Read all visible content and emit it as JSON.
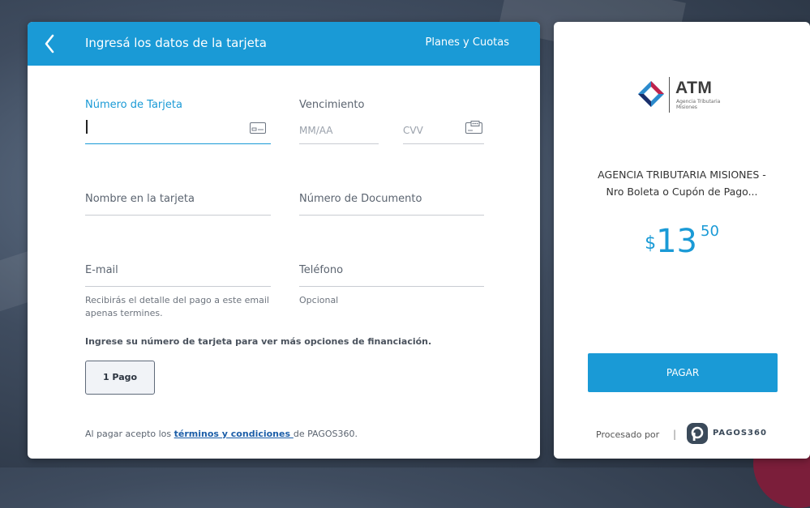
{
  "header": {
    "title": "Ingresá los datos de la tarjeta",
    "plans_link": "Planes y Cuotas"
  },
  "form": {
    "card_number": {
      "label": "Número de Tarjeta",
      "value": ""
    },
    "expiry": {
      "label": "Vencimiento",
      "placeholder": "MM/AA"
    },
    "cvv": {
      "placeholder": "CVV"
    },
    "cardholder_name": {
      "label": "Nombre en la tarjeta"
    },
    "document_number": {
      "label": "Número de Documento"
    },
    "email": {
      "label": "E-mail",
      "hint": "Recibirás el detalle del pago a este email apenas termines."
    },
    "phone": {
      "label": "Teléfono",
      "hint": "Opcional"
    }
  },
  "financing": {
    "info": "Ingrese su número de tarjeta para ver más opciones de financiación.",
    "options": [
      "1 Pago"
    ]
  },
  "terms": {
    "prefix": "Al pagar acepto los ",
    "link": "términos y condiciones ",
    "suffix": "de PAGOS360."
  },
  "summary": {
    "logo_text": "ATM",
    "logo_subtext": "Agencia Tributaria Misiones",
    "merchant_line1": "AGENCIA TRIBUTARIA MISIONES -",
    "merchant_line2": "Nro Boleta o Cupón de Pago...",
    "currency": "$",
    "amount_int": "13",
    "amount_cents": "50",
    "pay_button": "PAGAR",
    "processed_by": "Procesado por",
    "separator": "|",
    "provider": "PAGOS360"
  },
  "colors": {
    "accent": "#1a9ad6",
    "link": "#1c5ea8"
  },
  "icons": {
    "back": "chevron-left-icon",
    "card": "card-icon",
    "cvv": "cvv-card-icon",
    "logo": "atm-logo-icon",
    "provider": "pagos360-icon"
  }
}
